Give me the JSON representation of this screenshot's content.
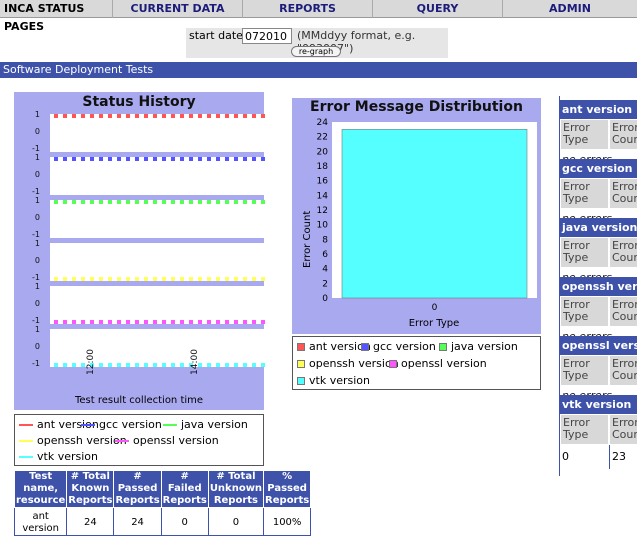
{
  "nav": {
    "brand": "INCA STATUS PAGES",
    "items": [
      "CURRENT DATA",
      "REPORTS",
      "QUERY",
      "ADMIN"
    ]
  },
  "date": {
    "label": "start date:",
    "value": "072010",
    "hint": "(MMddyy format, e.g. \"093007\")",
    "button": "re-graph"
  },
  "section_title": "Software Deployment Tests",
  "status_history": {
    "title": "Status History",
    "xlabel": "Test result collection time",
    "xticks": [
      "12:00",
      "14:00"
    ],
    "ytick_top": "1",
    "ytick_mid": "0",
    "ytick_bottom": "-1",
    "series": [
      {
        "name": "ant version",
        "color": "#ff5555",
        "level": 1
      },
      {
        "name": "gcc version",
        "color": "#5555ff",
        "level": 1
      },
      {
        "name": "java version",
        "color": "#55ff55",
        "level": 1
      },
      {
        "name": "openssh version",
        "color": "#ffff55",
        "level": -1
      },
      {
        "name": "openssl version",
        "color": "#ff55ff",
        "level": -1
      },
      {
        "name": "vtk version",
        "color": "#55ffff",
        "level": -1
      }
    ]
  },
  "chart_data": {
    "type": "bar",
    "title": "Error Message Distribution",
    "xlabel": "Error Type",
    "ylabel": "Error Count",
    "categories": [
      "0"
    ],
    "values": [
      23
    ],
    "ylim": [
      0,
      24
    ],
    "yticks": [
      "0",
      "2",
      "4",
      "6",
      "8",
      "10",
      "12",
      "14",
      "16",
      "18",
      "20",
      "22",
      "24"
    ],
    "bar_color": "#55ffff",
    "legend": [
      {
        "name": "ant version",
        "color": "#ff5555"
      },
      {
        "name": "gcc version",
        "color": "#5555ff"
      },
      {
        "name": "java version",
        "color": "#55ff55"
      },
      {
        "name": "openssh version",
        "color": "#ffff55"
      },
      {
        "name": "openssl version",
        "color": "#ff55ff"
      },
      {
        "name": "vtk version",
        "color": "#55ffff"
      }
    ]
  },
  "stats_table": {
    "headers": [
      "Test name, resource",
      "# Total Known Reports",
      "# Passed Reports",
      "# Failed Reports",
      "# Total Unknown Reports",
      "% Passed Reports"
    ],
    "rows": [
      [
        "ant version",
        "24",
        "24",
        "0",
        "0",
        "100%"
      ]
    ]
  },
  "error_tables": {
    "col1": "Error Type",
    "col2": "Error Count",
    "sections": [
      {
        "title": "ant version",
        "note": "no errors"
      },
      {
        "title": "gcc version",
        "note": "no errors"
      },
      {
        "title": "java version",
        "note": "no errors"
      },
      {
        "title": "openssh version",
        "note": "no errors"
      },
      {
        "title": "openssl version",
        "note": "no errors"
      },
      {
        "title": "vtk version",
        "note": "",
        "type": "0",
        "count": "23"
      }
    ]
  }
}
